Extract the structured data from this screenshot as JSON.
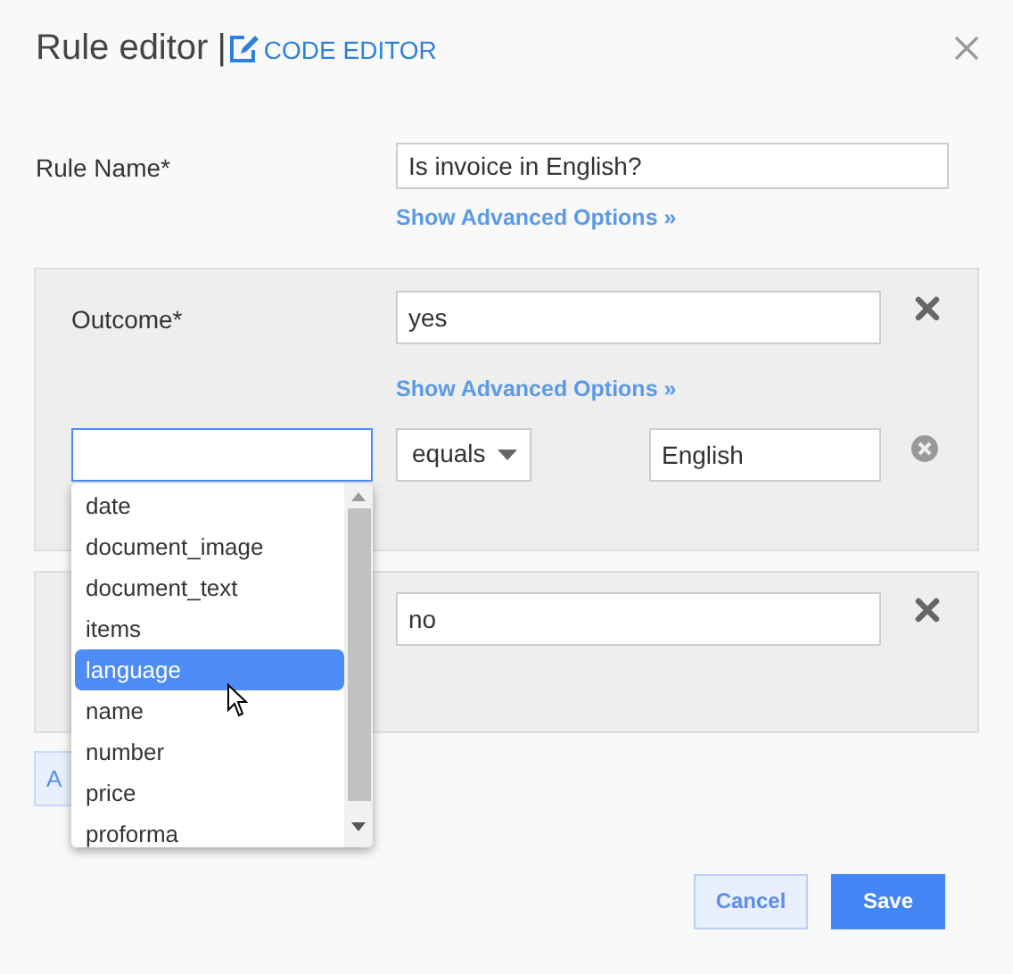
{
  "dialog": {
    "title": "Rule editor",
    "separator": "|",
    "code_editor_link": "CODE EDITOR"
  },
  "rule_name": {
    "label": "Rule Name*",
    "value": "Is invoice in English?",
    "advanced_link": "Show Advanced Options »"
  },
  "outcomes": [
    {
      "label": "Outcome*",
      "value": "yes",
      "advanced_link": "Show Advanced Options »",
      "conditions": [
        {
          "field_focused": true,
          "operator": "equals",
          "value": "English",
          "dropdown": {
            "options": [
              {
                "label": "date",
                "selected": false
              },
              {
                "label": "document_image",
                "selected": false
              },
              {
                "label": "document_text",
                "selected": false
              },
              {
                "label": "items",
                "selected": false
              },
              {
                "label": "language",
                "selected": true
              },
              {
                "label": "name",
                "selected": false
              },
              {
                "label": "number",
                "selected": false
              },
              {
                "label": "price",
                "selected": false
              },
              {
                "label": "proforma",
                "selected": false
              }
            ]
          }
        }
      ]
    },
    {
      "value": "no"
    }
  ],
  "add_button": {
    "label": "A"
  },
  "buttons": [
    {
      "kind": "secondary",
      "label": "Cancel"
    },
    {
      "kind": "primary",
      "label": "Save"
    }
  ]
}
